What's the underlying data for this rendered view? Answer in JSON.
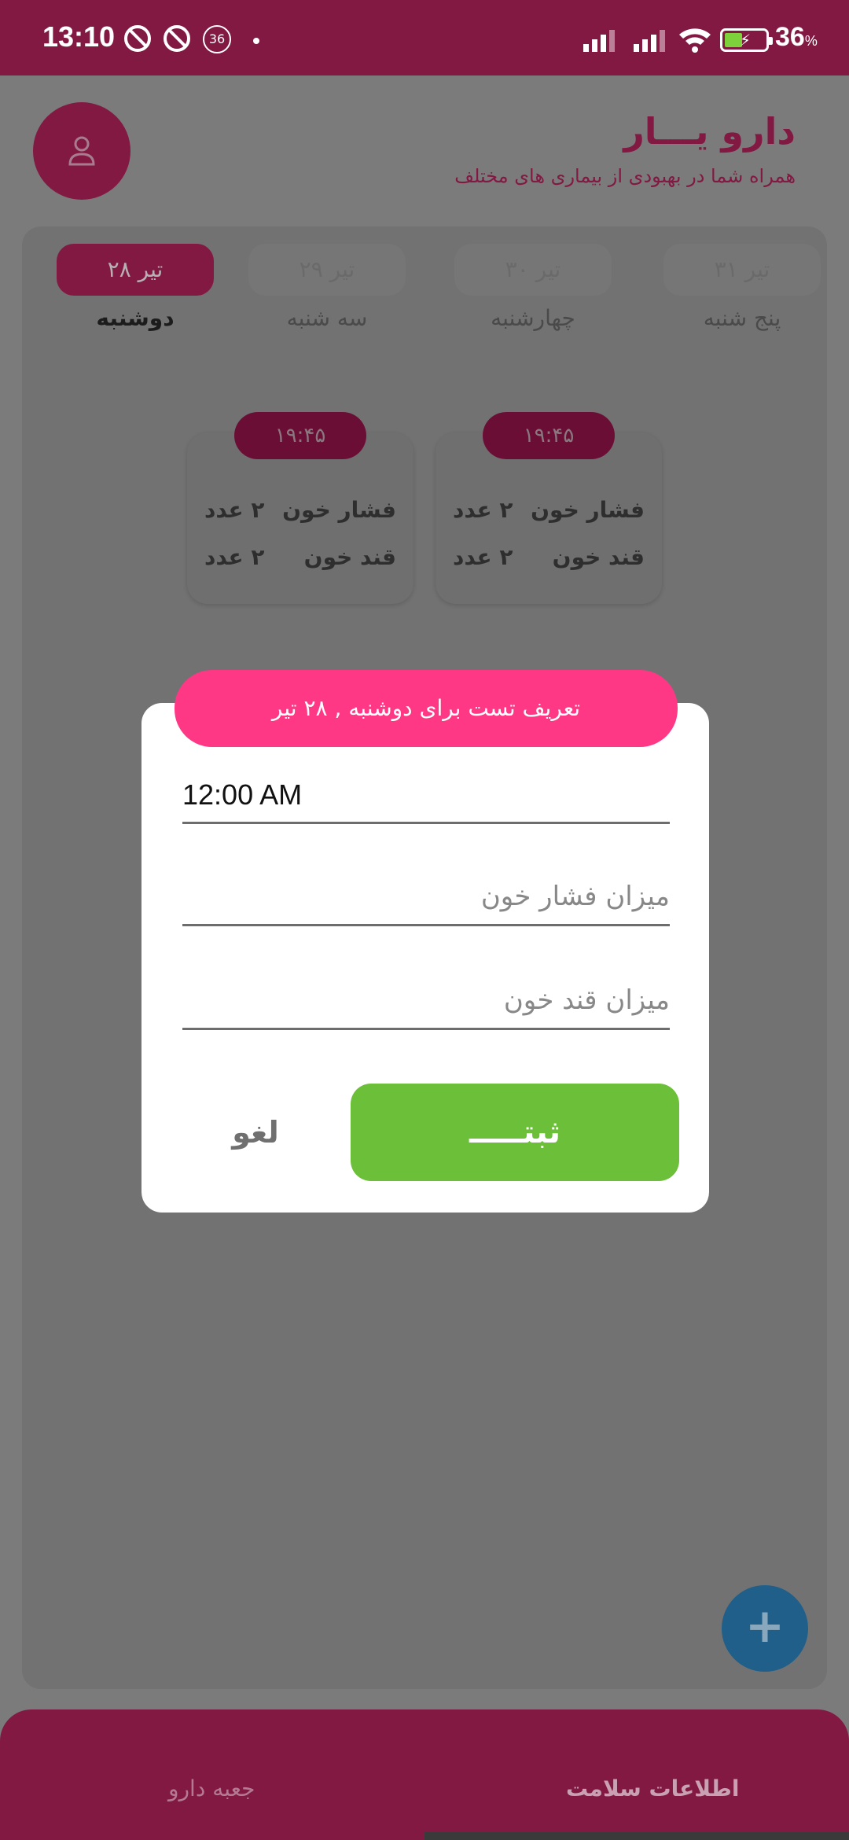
{
  "status_bar": {
    "time": "13:10",
    "notification_badge": "36",
    "battery_percent": "36",
    "battery_unit": "%"
  },
  "header": {
    "title": "دارو یـــار",
    "subtitle": "همراه شما در بهبودی از بیماری های مختلف"
  },
  "days": [
    {
      "date": "تیر ۳۱",
      "weekday": "پنج شنبه",
      "active": false
    },
    {
      "date": "تیر ۳۰",
      "weekday": "چهارشنبه",
      "active": false
    },
    {
      "date": "تیر ۲۹",
      "weekday": "سه شنبه",
      "active": false
    },
    {
      "date": "تیر ۲۸",
      "weekday": "دوشنبه",
      "active": true
    }
  ],
  "cards": [
    {
      "time": "۱۹:۴۵",
      "bp_label": "فشار خون",
      "bp_value": "۲ عدد",
      "bs_label": "قند خون",
      "bs_value": "۲ عدد"
    },
    {
      "time": "۱۹:۴۵",
      "bp_label": "فشار خون",
      "bp_value": "۲ عدد",
      "bs_label": "قند خون",
      "bs_value": "۲ عدد"
    }
  ],
  "dialog": {
    "header": "تعریف تست برای  دوشنبه , ۲۸ تیر",
    "time_value": "12:00 AM",
    "bp_placeholder": "میزان فشار خون",
    "bs_placeholder": "میزان قند خون",
    "save_label": "ثبتـــــ",
    "cancel_label": "لغو"
  },
  "fab": {
    "label": "+"
  },
  "bottom_nav": {
    "health_info": "اطلاعات سلامت",
    "medicine_box": "جعبه دارو"
  },
  "colors": {
    "brand": "#821942",
    "dialog_header": "#ff3886",
    "save_button": "#6bbf39",
    "fab": "#2a8bd1"
  }
}
